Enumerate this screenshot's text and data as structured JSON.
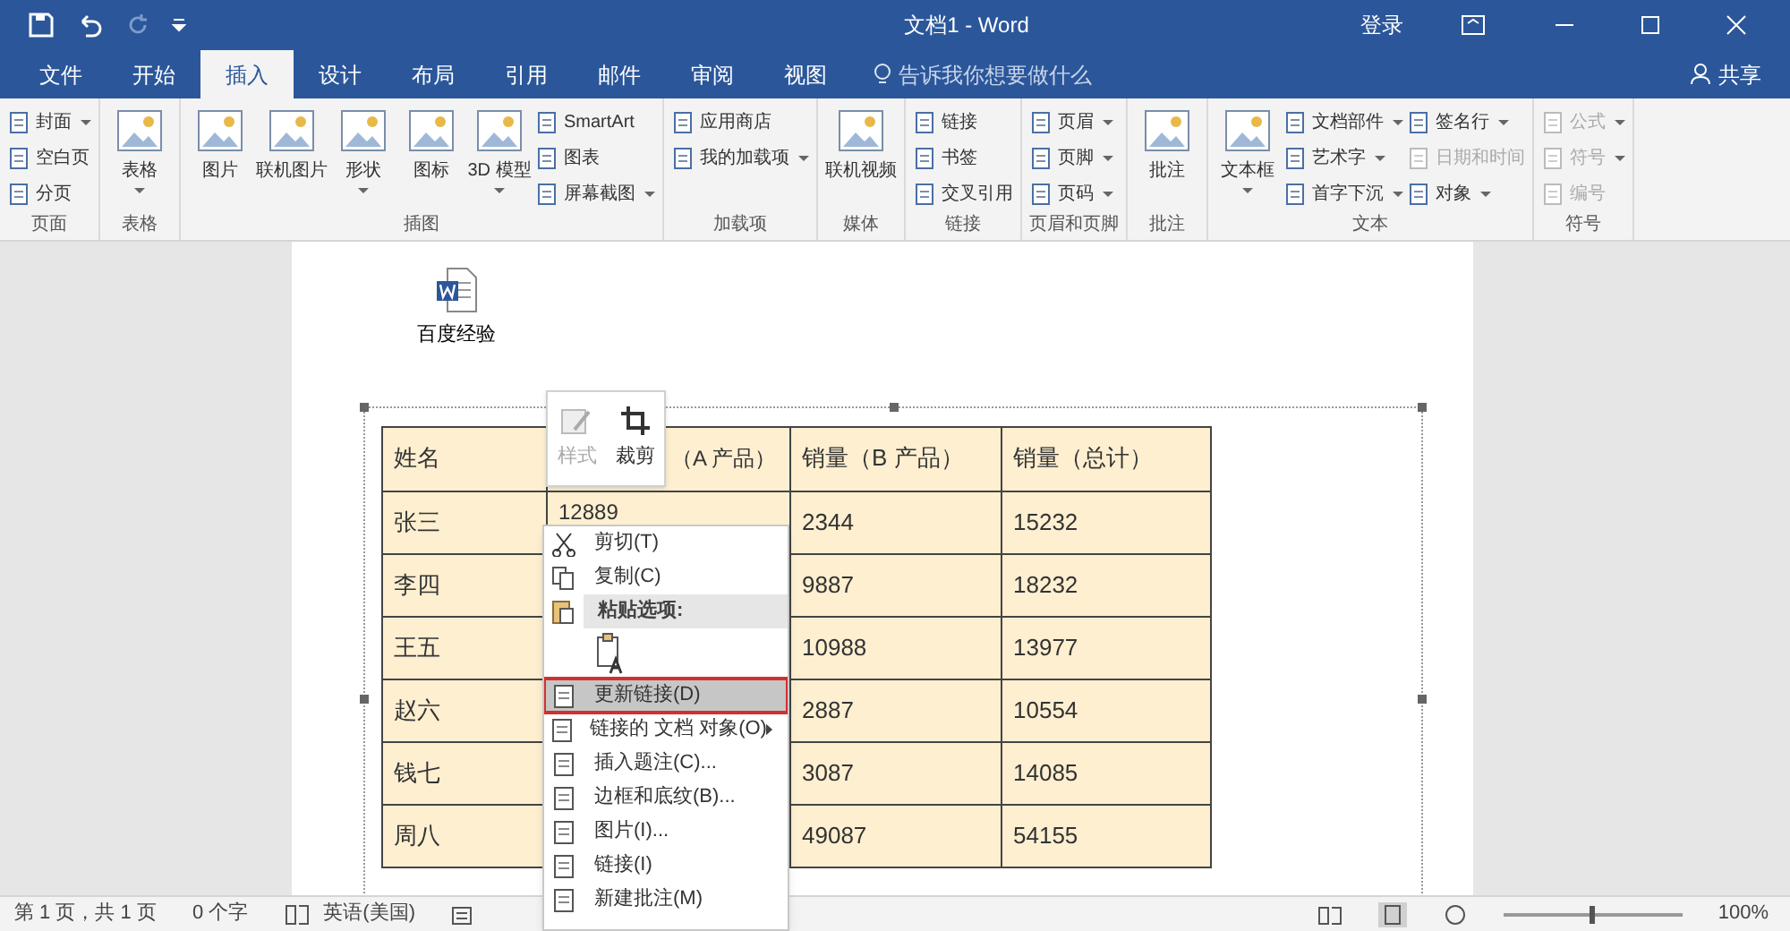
{
  "window": {
    "title": "文档1 - Word",
    "signin": "登录",
    "share": "共享"
  },
  "tabs": [
    {
      "label": "文件",
      "selected": false
    },
    {
      "label": "开始",
      "selected": false
    },
    {
      "label": "插入",
      "selected": true
    },
    {
      "label": "设计",
      "selected": false
    },
    {
      "label": "布局",
      "selected": false
    },
    {
      "label": "引用",
      "selected": false
    },
    {
      "label": "邮件",
      "selected": false
    },
    {
      "label": "审阅",
      "selected": false
    },
    {
      "label": "视图",
      "selected": false
    }
  ],
  "tell_me": {
    "placeholder": "告诉我你想要做什么"
  },
  "ribbon": [
    {
      "label": "页面",
      "items": [
        {
          "kind": "small",
          "label": "封面",
          "dropdown": true,
          "disabled": false
        },
        {
          "kind": "small",
          "label": "空白页",
          "dropdown": false,
          "disabled": false
        },
        {
          "kind": "small",
          "label": "分页",
          "dropdown": false,
          "disabled": false
        }
      ]
    },
    {
      "label": "表格",
      "items": [
        {
          "kind": "large",
          "label": "表格",
          "dropdown": true,
          "disabled": false
        }
      ]
    },
    {
      "label": "插图",
      "items": [
        {
          "kind": "large",
          "label": "图片",
          "dropdown": false,
          "disabled": false
        },
        {
          "kind": "large",
          "label": "联机图片",
          "dropdown": false,
          "disabled": false
        },
        {
          "kind": "large",
          "label": "形状",
          "dropdown": true,
          "disabled": false
        },
        {
          "kind": "large",
          "label": "图标",
          "dropdown": false,
          "disabled": false
        },
        {
          "kind": "large",
          "label": "3D 模型",
          "dropdown": true,
          "disabled": false
        },
        {
          "kind": "small",
          "label": "SmartArt",
          "dropdown": false,
          "disabled": false
        },
        {
          "kind": "small",
          "label": "图表",
          "dropdown": false,
          "disabled": false
        },
        {
          "kind": "small",
          "label": "屏幕截图",
          "dropdown": true,
          "disabled": false
        }
      ]
    },
    {
      "label": "加载项",
      "items": [
        {
          "kind": "small",
          "label": "应用商店",
          "dropdown": false,
          "disabled": false
        },
        {
          "kind": "small",
          "label": "我的加载项",
          "dropdown": true,
          "disabled": false
        }
      ]
    },
    {
      "label": "媒体",
      "items": [
        {
          "kind": "large",
          "label": "联机视频",
          "dropdown": false,
          "disabled": false
        }
      ]
    },
    {
      "label": "链接",
      "items": [
        {
          "kind": "small",
          "label": "链接",
          "dropdown": false,
          "disabled": false
        },
        {
          "kind": "small",
          "label": "书签",
          "dropdown": false,
          "disabled": false
        },
        {
          "kind": "small",
          "label": "交叉引用",
          "dropdown": false,
          "disabled": false
        }
      ]
    },
    {
      "label": "页眉和页脚",
      "items": [
        {
          "kind": "small",
          "label": "页眉",
          "dropdown": true,
          "disabled": false
        },
        {
          "kind": "small",
          "label": "页脚",
          "dropdown": true,
          "disabled": false
        },
        {
          "kind": "small",
          "label": "页码",
          "dropdown": true,
          "disabled": false
        }
      ]
    },
    {
      "label": "批注",
      "items": [
        {
          "kind": "large",
          "label": "批注",
          "dropdown": false,
          "disabled": false
        }
      ]
    },
    {
      "label": "文本",
      "items": [
        {
          "kind": "large",
          "label": "文本框",
          "dropdown": true,
          "disabled": false
        },
        {
          "kind": "small",
          "label": "文档部件",
          "dropdown": true,
          "disabled": false
        },
        {
          "kind": "small",
          "label": "艺术字",
          "dropdown": true,
          "disabled": false
        },
        {
          "kind": "small",
          "label": "首字下沉",
          "dropdown": true,
          "disabled": false
        },
        {
          "kind": "small",
          "label": "签名行",
          "dropdown": true,
          "disabled": false
        },
        {
          "kind": "small",
          "label": "日期和时间",
          "dropdown": false,
          "disabled": true
        },
        {
          "kind": "small",
          "label": "对象",
          "dropdown": true,
          "disabled": false
        }
      ]
    },
    {
      "label": "符号",
      "items": [
        {
          "kind": "small",
          "label": "公式",
          "dropdown": true,
          "disabled": true
        },
        {
          "kind": "small",
          "label": "符号",
          "dropdown": true,
          "disabled": true
        },
        {
          "kind": "small",
          "label": "编号",
          "dropdown": false,
          "disabled": true
        }
      ]
    }
  ],
  "document": {
    "embedded_icon_label": "百度经验",
    "table": {
      "columns": [
        "姓名",
        "（A 产品）",
        "销量（B 产品）",
        "销量（总计）"
      ],
      "rows": [
        [
          "张三",
          "12889",
          "2344",
          "15232"
        ],
        [
          "李四",
          "",
          "9887",
          "18232"
        ],
        [
          "王五",
          "",
          "10988",
          "13977"
        ],
        [
          "赵六",
          "",
          "2887",
          "10554"
        ],
        [
          "钱七",
          "",
          "3087",
          "14085"
        ],
        [
          "周八",
          "",
          "49087",
          "54155"
        ]
      ]
    }
  },
  "mini_toolbar": [
    {
      "label": "样式",
      "disabled": true
    },
    {
      "label": "裁剪",
      "disabled": false
    }
  ],
  "context_menu": [
    {
      "kind": "item",
      "label": "剪切(T)",
      "selected": false
    },
    {
      "kind": "item",
      "label": "复制(C)",
      "selected": false
    },
    {
      "kind": "header",
      "label": "粘贴选项:"
    },
    {
      "kind": "paste"
    },
    {
      "kind": "item",
      "label": "更新链接(D)",
      "selected": true
    },
    {
      "kind": "submenu",
      "label": "链接的 文档 对象(O)",
      "selected": false
    },
    {
      "kind": "item",
      "label": "插入题注(C)...",
      "selected": false
    },
    {
      "kind": "item",
      "label": "边框和底纹(B)...",
      "selected": false
    },
    {
      "kind": "item",
      "label": "图片(I)...",
      "selected": false
    },
    {
      "kind": "item",
      "label": "链接(I)",
      "selected": false
    },
    {
      "kind": "item",
      "label": "新建批注(M)",
      "selected": false
    }
  ],
  "status_bar": {
    "page": "第 1 页，共 1 页",
    "words": "0 个字",
    "language": "英语(美国)",
    "zoom": "100%",
    "zoom_slider": {
      "level": 0.5
    }
  }
}
